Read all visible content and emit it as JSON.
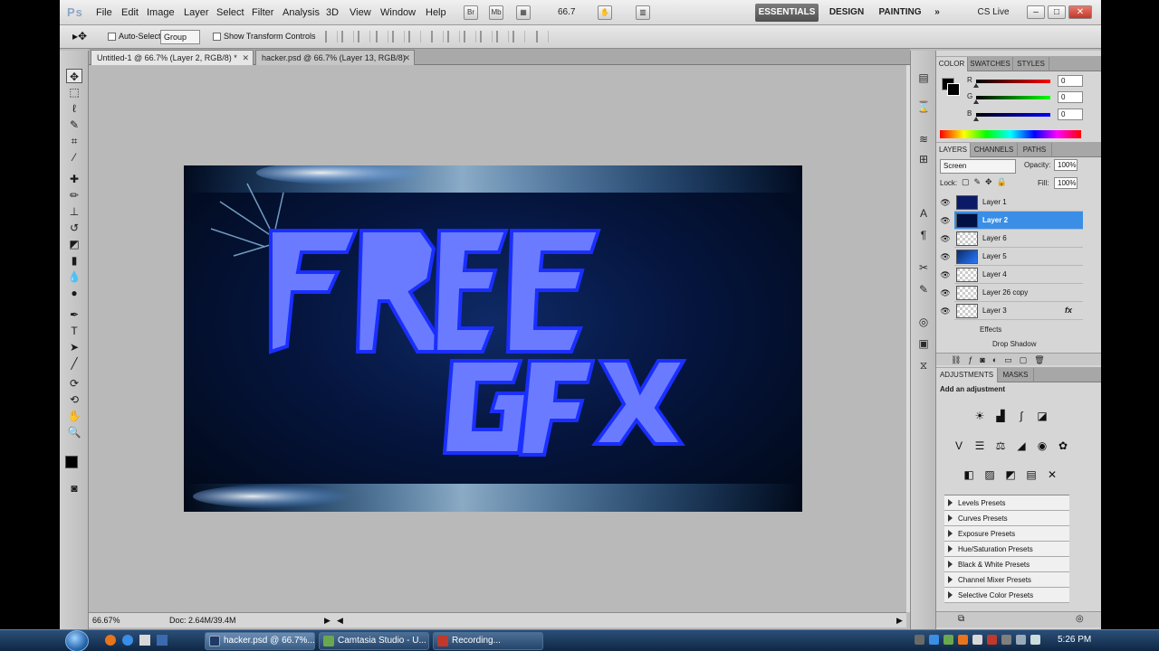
{
  "app": {
    "logo": "Ps"
  },
  "menu": [
    "File",
    "Edit",
    "Image",
    "Layer",
    "Select",
    "Filter",
    "Analysis",
    "3D",
    "View",
    "Window",
    "Help"
  ],
  "menubar": {
    "zoom": "66.7",
    "workspaces": [
      "ESSENTIALS",
      "DESIGN",
      "PAINTING"
    ],
    "more": "»",
    "cslive": "CS Live"
  },
  "options": {
    "auto_select_label": "Auto-Select:",
    "auto_select_value": "Group",
    "show_transform": "Show Transform Controls"
  },
  "tabs": [
    {
      "label": "Untitled-1 @ 66.7% (Layer 2, RGB/8) *",
      "active": true
    },
    {
      "label": "hacker.psd @ 66.7% (Layer 13, RGB/8)",
      "active": false
    }
  ],
  "artwork": {
    "line1": "FREE",
    "line2": "GFX"
  },
  "status": {
    "zoom": "66.67%",
    "doc": "Doc: 2.64M/39.4M"
  },
  "color_panel": {
    "tabs": [
      "COLOR",
      "SWATCHES",
      "STYLES"
    ],
    "r_label": "R",
    "g_label": "G",
    "b_label": "B",
    "r": "0",
    "g": "0",
    "b": "0"
  },
  "layers_panel": {
    "tabs": [
      "LAYERS",
      "CHANNELS",
      "PATHS"
    ],
    "blend": "Screen",
    "opacity_label": "Opacity:",
    "opacity": "100%",
    "lock_label": "Lock:",
    "fill_label": "Fill:",
    "fill": "100%",
    "layers": [
      "Layer 1",
      "Layer 2",
      "Layer 6",
      "Layer 5",
      "Layer 4",
      "Layer 26 copy",
      "Layer 3"
    ],
    "fx": "fx",
    "effects": "Effects",
    "drop_shadow": "Drop Shadow"
  },
  "adjustments_panel": {
    "tabs": [
      "ADJUSTMENTS",
      "MASKS"
    ],
    "title": "Add an adjustment",
    "presets": [
      "Levels Presets",
      "Curves Presets",
      "Exposure Presets",
      "Hue/Saturation Presets",
      "Black & White Presets",
      "Channel Mixer Presets",
      "Selective Color Presets"
    ]
  },
  "taskbar": {
    "buttons": [
      "hacker.psd @ 66.7%...",
      "Camtasia Studio - U...",
      "Recording..."
    ],
    "time": "5:26 PM"
  },
  "colors": {
    "accent": "#3a8ee6",
    "text_fill": "#6a7bff",
    "text_stroke": "#1a2fff"
  }
}
